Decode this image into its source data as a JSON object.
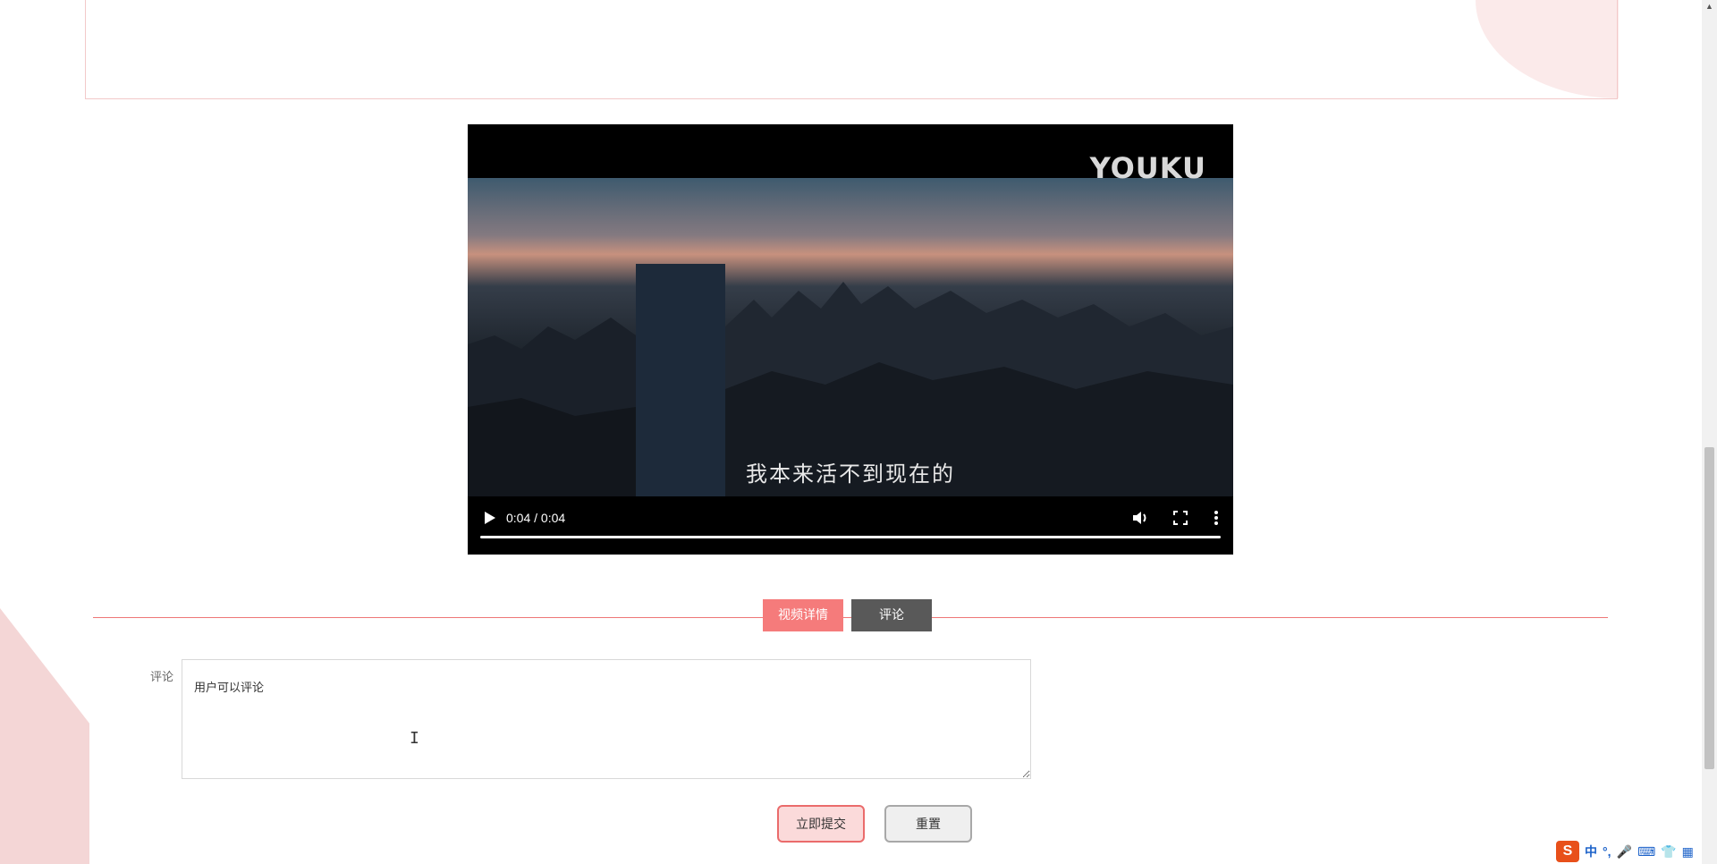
{
  "video": {
    "watermark": "YOUKU",
    "subtitle": "我本来活不到现在的",
    "time": "0:04 / 0:04",
    "progress_fraction": 1.0
  },
  "tabs": [
    {
      "label": "视频详情",
      "active": true
    },
    {
      "label": "评论",
      "active": false
    }
  ],
  "comment_form": {
    "label": "评论",
    "value": "用户可以评论",
    "submit_label": "立即提交",
    "reset_label": "重置"
  },
  "ime": {
    "logo": "S",
    "items": [
      "中",
      "°,",
      "🎤",
      "⌨",
      "👕",
      "▦"
    ]
  },
  "colors": {
    "accent": "#f57b7b",
    "tab_inactive": "#595959",
    "divider": "#ee7777"
  }
}
